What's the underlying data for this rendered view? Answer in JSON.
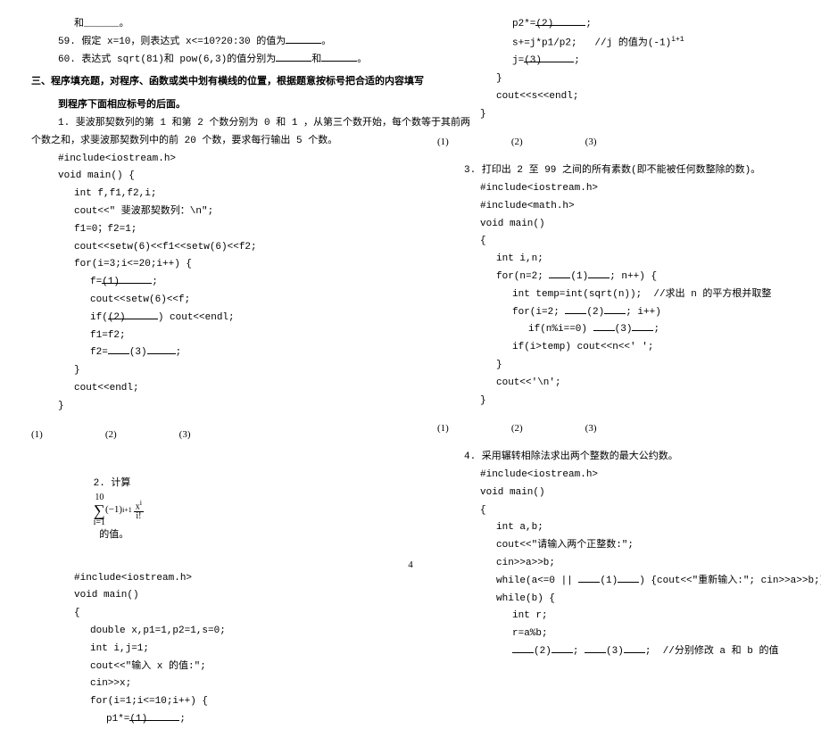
{
  "col1": {
    "l01": "和______。",
    "q59_pre": "59. 假定 x=10，则表达式 x<=10?20:30 的值为",
    "q59_post": "。",
    "q60_pre": "60. 表达式 sqrt(81)和 pow(6,3)的值分别为",
    "q60_mid": "和",
    "q60_post": "。",
    "section3_title": "三、程序填充题，对程序、函数或类中划有横线的位置，根据题意按标号把合适的内容填写",
    "section3_title2": "到程序下面相应标号的后面。",
    "p1_desc1": "1. 斐波那契数列的第 1 和第 2 个数分别为 0 和 1 ，从第三个数开始，每个数等于其前两",
    "p1_desc2": "个数之和，求斐波那契数列中的前 20 个数，要求每行输出 5 个数。",
    "c01": "#include<iostream.h>",
    "c02": "void main() {",
    "c03": "int f,f1,f2,i;",
    "c04": "cout<<\" 斐波那契数列：\\n\";",
    "c05": "f1=0；f2=1;",
    "c06": "cout<<setw(6)<<f1<<setw(6)<<f2;",
    "c07": "for(i=3;i<=20;i++) {",
    "c08a": "f=",
    "c08b": "(1)",
    "c08c": ";",
    "c09": "cout<<setw(6)<<f;",
    "c10a": "if(",
    "c10b": "(2)",
    "c10c": ") cout<<endl;",
    "c11": "f1=f2;",
    "c12a": "f2=",
    "c12b": "(3)",
    "c12c": ";",
    "c13": "}",
    "c14": "cout<<endl;",
    "c15": "}",
    "ans1": "(1)",
    "ans2": "(2)",
    "ans3": "(3)",
    "p2_pre": "2. 计算",
    "p2_sig_top": "10",
    "p2_sig_bot": "i=1",
    "p2_mid1": "(−1)",
    "p2_exp1": "i+1",
    "p2_frac_num": "x",
    "p2_frac_num_exp": "i",
    "p2_frac_den": "i!",
    "p2_post": " 的值。",
    "d01": "#include<iostream.h>",
    "d02": "void main()",
    "d03": "{",
    "d04": "double x,p1=1,p2=1,s=0;",
    "d05": "int i,j=1;",
    "d06": "cout<<\"输入 x 的值:\";",
    "d07": "cin>>x;",
    "d08": "for(i=1;i<=10;i++) {",
    "d09a": "p1*=",
    "d09b": "(1)",
    "d09c": ";"
  },
  "col2": {
    "e01a": "p2*=",
    "e01b": "(2)",
    "e01c": ";",
    "e02a": "s+=j*p1/p2;   //j 的值为(-1)",
    "e02exp": "i+1",
    "e03a": "j=",
    "e03b": "(3)",
    "e03c": ";",
    "e04": "}",
    "e05": "cout<<s<<endl;",
    "e06": "}",
    "ans1": "(1)",
    "ans2": "(2)",
    "ans3": "(3)",
    "p3_desc": "3. 打印出 2 至 99 之间的所有素数(即不能被任何数整除的数)。",
    "f01": "#include<iostream.h>",
    "f02": "#include<math.h>",
    "f03": "void main()",
    "f04": "{",
    "f05": "int i,n;",
    "f06a": "for(n=2; ",
    "f06b": "(1)",
    "f06c": "; n++) {",
    "f07": "int temp=int(sqrt(n));  //求出 n 的平方根并取整",
    "f08a": "for(i=2; ",
    "f08b": "(2)",
    "f08c": "; i++)",
    "f09a": "if(n%i==0) ",
    "f09b": "(3)",
    "f09c": ";",
    "f10": "if(i>temp) cout<<n<<' ';",
    "f11": "}",
    "f12": "cout<<'\\n';",
    "f13": "}",
    "p4_desc": "4. 采用辗转相除法求出两个整数的最大公约数。",
    "g01": "#include<iostream.h>",
    "g02": "void main()",
    "g03": "{",
    "g04": "int a,b;",
    "g05": "cout<<\"请输入两个正整数:\";",
    "g06": "cin>>a>>b;",
    "g07a": "while(a<=0 || ",
    "g07b": "(1)",
    "g07c": ") {cout<<\"重新输入:\"; cin>>a>>b;}",
    "g08": "while(b) {",
    "g09": "int r;",
    "g10": "r=a%b;",
    "g11a": "",
    "g11b": "(2)",
    "g11c": "; ",
    "g11d": "(3)",
    "g11e": ";  //分别修改 a 和 b 的值"
  },
  "pageNum": "4"
}
